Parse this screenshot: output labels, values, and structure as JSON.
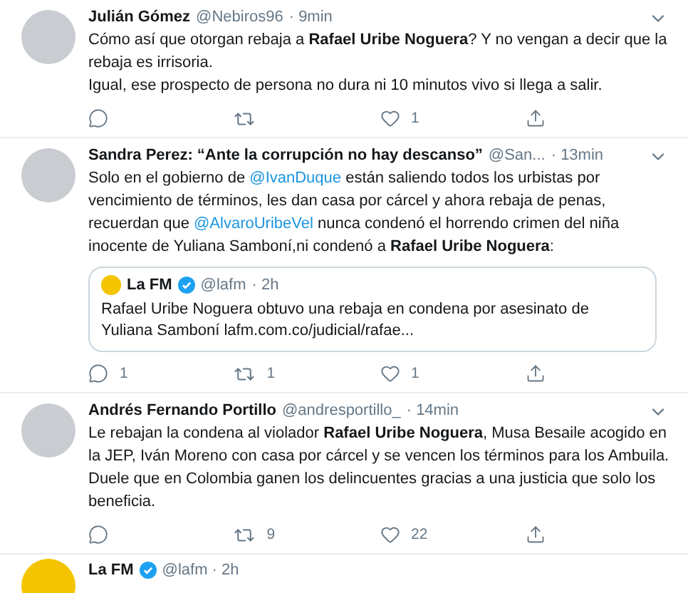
{
  "tweets": [
    {
      "name": "Julián Gómez",
      "handle": "@Nebiros96",
      "time": "· 9min",
      "body": [
        {
          "kind": "plain",
          "text": "Cómo así que otorgan rebaja a "
        },
        {
          "kind": "bold",
          "text": "Rafael Uribe Noguera"
        },
        {
          "kind": "plain",
          "text": "? Y no vengan a decir que la rebaja es irrisoria.\nIgual, ese prospecto de persona no dura ni 10 minutos vivo si llega a salir."
        }
      ],
      "actions": {
        "likes": "1"
      }
    },
    {
      "name": "Sandra Perez: “Ante la corrupción no hay descanso”",
      "handle": "@San...",
      "time": "· 13min",
      "body": [
        {
          "kind": "plain",
          "text": "Solo en el gobierno de "
        },
        {
          "kind": "mention",
          "text": "@IvanDuque"
        },
        {
          "kind": "plain",
          "text": " están saliendo todos los urbistas por vencimiento de términos, les dan casa por cárcel y ahora rebaja de penas, recuerdan que "
        },
        {
          "kind": "mention",
          "text": "@AlvaroUribeVel"
        },
        {
          "kind": "plain",
          "text": " nunca condenó el horrendo crimen del niña inocente de Yuliana Samboní,ni condenó a "
        },
        {
          "kind": "bold",
          "text": "Rafael Uribe Noguera"
        },
        {
          "kind": "plain",
          "text": ":"
        }
      ],
      "quote": {
        "name": "La FM",
        "verified": true,
        "handle": "@lafm",
        "time": "· 2h",
        "text": "Rafael Uribe Noguera obtuvo una rebaja en condena por asesinato de Yuliana Samboní lafm.com.co/judicial/rafae..."
      },
      "actions": {
        "replies": "1",
        "retweets": "1",
        "likes": "1"
      }
    },
    {
      "name": "Andrés Fernando Portillo",
      "handle": "@andresportillo_",
      "time": "· 14min",
      "body": [
        {
          "kind": "plain",
          "text": "Le rebajan la condena al violador "
        },
        {
          "kind": "bold",
          "text": "Rafael Uribe Noguera"
        },
        {
          "kind": "plain",
          "text": ", Musa Besaile acogido en la JEP, Iván Moreno con casa por cárcel y se vencen los términos para los Ambuila. Duele que en Colombia ganen los delincuentes gracias a una justicia que solo los beneficia."
        }
      ],
      "actions": {
        "retweets": "9",
        "likes": "22"
      }
    }
  ],
  "next_tweet": {
    "name": "La FM",
    "verified": true,
    "handle": "@lafm · 2h"
  }
}
